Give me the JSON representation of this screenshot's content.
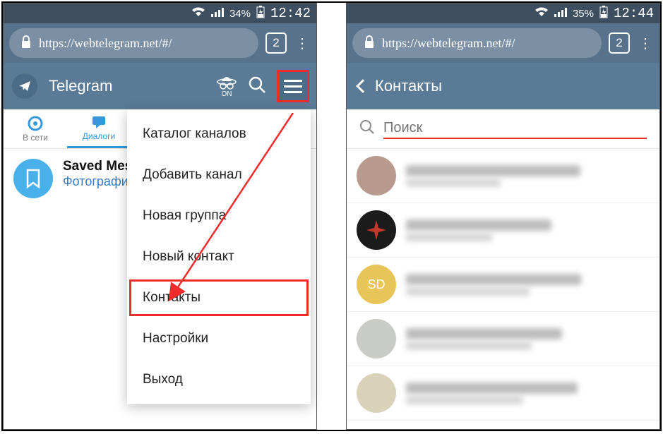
{
  "left": {
    "status": {
      "battery": "34%",
      "time": "12:42"
    },
    "url": "https://webtelegram.net/#/",
    "tabcount": "2",
    "app_title": "Telegram",
    "incog_label": "ON",
    "tabs": {
      "online": "В сети",
      "dialogs": "Диалоги"
    },
    "chat": {
      "title": "Saved Mess",
      "subtitle": "Фотографи"
    },
    "menu": [
      "Каталог каналов",
      "Добавить канал",
      "Новая группа",
      "Новый контакт",
      "Контакты",
      "Настройки",
      "Выход"
    ]
  },
  "right": {
    "status": {
      "battery": "35%",
      "time": "12:44"
    },
    "url": "https://webtelegram.net/#/",
    "tabcount": "2",
    "header": "Контакты",
    "search_placeholder": "Поиск",
    "contacts": [
      {
        "avatar_bg": "#b89a8e",
        "initials": ""
      },
      {
        "avatar_bg": "#1b1b1b",
        "initials": ""
      },
      {
        "avatar_bg": "#e8c559",
        "initials": "SD"
      },
      {
        "avatar_bg": "#c8cbc6",
        "initials": ""
      },
      {
        "avatar_bg": "#d8d2b8",
        "initials": ""
      }
    ]
  }
}
